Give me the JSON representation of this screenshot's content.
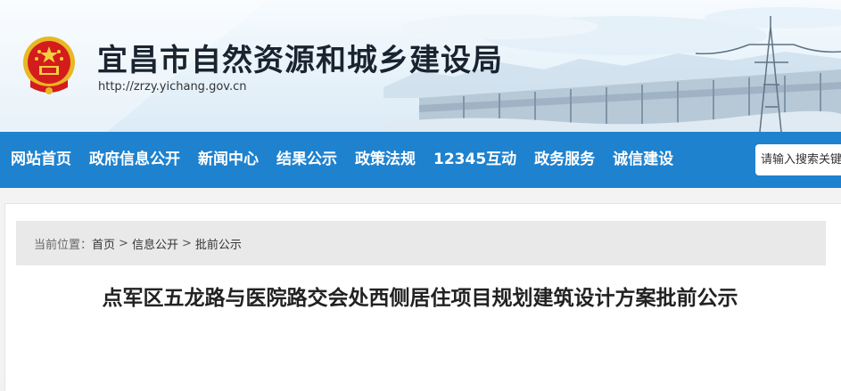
{
  "header": {
    "site_title": "宜昌市自然资源和城乡建设局",
    "site_url": "http://zrzy.yichang.gov.cn"
  },
  "nav": {
    "items": [
      {
        "label": "网站首页"
      },
      {
        "label": "政府信息公开"
      },
      {
        "label": "新闻中心"
      },
      {
        "label": "结果公示"
      },
      {
        "label": "政策法规"
      },
      {
        "label": "12345互动"
      },
      {
        "label": "政务服务"
      },
      {
        "label": "诚信建设"
      }
    ]
  },
  "search": {
    "placeholder": "请输入搜索关键"
  },
  "breadcrumb": {
    "prefix": "当前位置：",
    "items": [
      {
        "label": "首页"
      },
      {
        "label": "信息公开"
      },
      {
        "label": "批前公示"
      }
    ],
    "separator": ">"
  },
  "article": {
    "title": "点军区五龙路与医院路交会处西侧居住项目规划建筑设计方案批前公示"
  },
  "colors": {
    "nav_background": "#1e82cf",
    "breadcrumb_background": "#e9e9e9",
    "title_text": "#1a2430"
  },
  "icons": {
    "emblem": "national-emblem-icon"
  }
}
